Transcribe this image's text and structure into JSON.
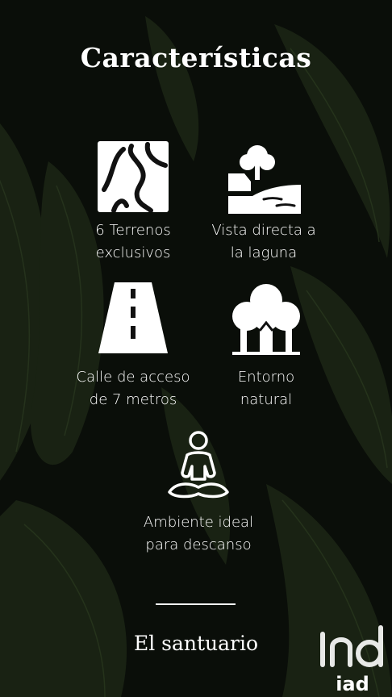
{
  "title": "Características",
  "features": [
    {
      "icon": "map-terrain-icon",
      "line1": "6 Terrenos",
      "line2": "exclusivos"
    },
    {
      "icon": "lagoon-view-icon",
      "line1": "Vista directa a",
      "line2": "la laguna"
    },
    {
      "icon": "road-icon",
      "line1": "Calle de acceso",
      "line2": "de 7 metros"
    },
    {
      "icon": "trees-icon",
      "line1": "Entorno",
      "line2": "natural"
    },
    {
      "icon": "meditation-icon",
      "line1": "Ambiente ideal",
      "line2": "para descanso"
    }
  ],
  "brand": "El santuario",
  "logo_text": "iad",
  "colors": {
    "background": "#0b0f0a",
    "foliage": "#1f2a17",
    "text": "#ffffff"
  }
}
